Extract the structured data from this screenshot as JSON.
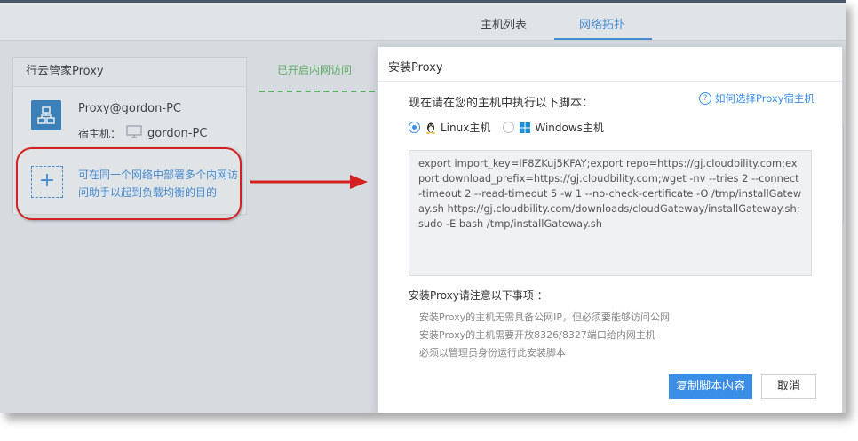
{
  "tabs": [
    {
      "label": "主机列表",
      "active": false
    },
    {
      "label": "网络拓扑",
      "active": true
    }
  ],
  "proxy_panel": {
    "title": "行云管家Proxy",
    "proxy_name": "Proxy@gordon-PC",
    "host_label": "宿主机：",
    "host_name": "gordon-PC",
    "add_text": "可在同一个网络中部署多个内网访问助手以起到负载均衡的目的"
  },
  "topology": {
    "status_label": "已开启内网访问"
  },
  "dialog": {
    "title": "安装Proxy",
    "prompt": "现在请在您的主机中执行以下脚本：",
    "help_link": "如何选择Proxy宿主机",
    "os_options": [
      {
        "label": "Linux主机",
        "selected": true,
        "icon": "linux-tux-icon"
      },
      {
        "label": "Windows主机",
        "selected": false,
        "icon": "windows-logo-icon"
      }
    ],
    "script": "export import_key=IF8ZKuj5KFAY;export repo=https://gj.cloudbility.com;export download_prefix=https://gj.cloudbility.com;wget -nv --tries 2 --connect-timeout 2 --read-timeout 5 -w 1 --no-check-certificate -O /tmp/installGateway.sh https://gj.cloudbility.com/downloads/cloudGateway/installGateway.sh;sudo -E bash /tmp/installGateway.sh",
    "notes_title": "安装Proxy请注意以下事项 ：",
    "notes": [
      "安装Proxy的主机无需具备公网IP，但必须要能够访问公网",
      "安装Proxy的主机需要开放8326/8327端口给内网主机",
      "必须以管理员身份运行此安装脚本"
    ],
    "copy_button": "复制脚本内容",
    "cancel_button": "取消"
  },
  "colors": {
    "accent": "#3a8ee6",
    "annotation_red": "#d42020",
    "status_green": "#5cb85c"
  }
}
